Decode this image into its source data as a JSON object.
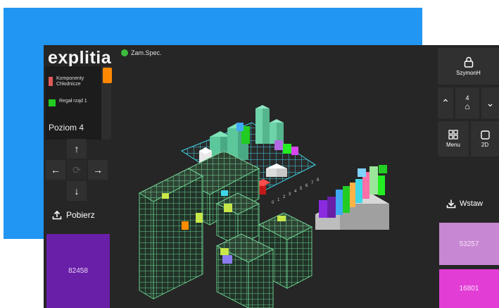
{
  "app": {
    "logo": "explitia",
    "status_label": "Zam.Spec."
  },
  "legend": {
    "items": [
      {
        "label": "Komponenty Chłodnicze",
        "color": "#e05a5a"
      },
      {
        "label": "Regał rząd 1",
        "color": "#22cc22"
      }
    ],
    "highlight_color": "#ff8800"
  },
  "level": {
    "label": "Poziom 4"
  },
  "download": {
    "label": "Pobierz"
  },
  "left_tile": {
    "value": "82458",
    "color": "#6a1fa8"
  },
  "user": {
    "name": "SzymonH"
  },
  "floor": {
    "value": "4"
  },
  "menu": {
    "label": "Menu"
  },
  "view": {
    "label": "2D"
  },
  "insert": {
    "label": "Wstaw"
  },
  "right_tiles": [
    {
      "value": "53257",
      "color": "#c887d2"
    },
    {
      "value": "16801",
      "color": "#e23ed6"
    }
  ],
  "grid_axis_labels": [
    "0",
    "1",
    "2",
    "3",
    "4",
    "5",
    "6",
    "7",
    "8"
  ]
}
